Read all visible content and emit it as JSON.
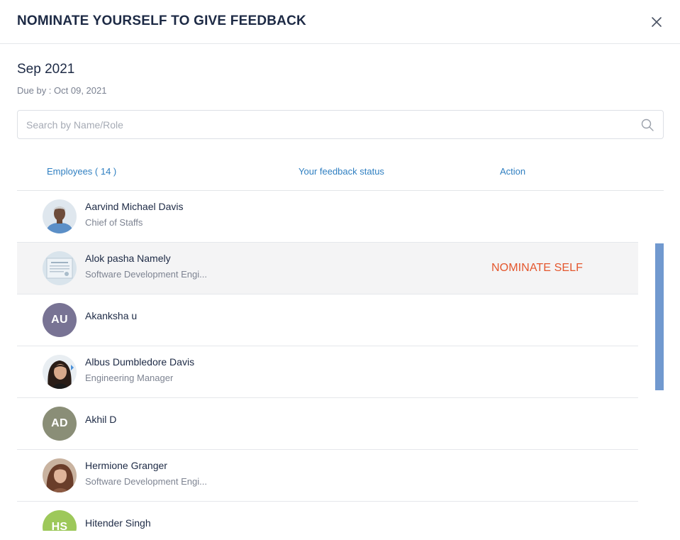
{
  "dialog": {
    "title": "NOMINATE YOURSELF TO GIVE FEEDBACK",
    "period": "Sep 2021",
    "due": "Due by : Oct 09, 2021",
    "search_placeholder": "Search by Name/Role",
    "search_value": ""
  },
  "columns": {
    "employees": "Employees ( 14 )",
    "status": "Your feedback status",
    "action": "Action"
  },
  "employees": [
    {
      "name": "Aarvind Michael Davis",
      "role": "Chief of Staffs",
      "avatar": "photo"
    },
    {
      "name": "Alok pasha Namely",
      "role": "Software Development Engi...",
      "avatar": "photo",
      "action": "NOMINATE SELF"
    },
    {
      "name": "Akanksha u",
      "initials": "AU",
      "avatar_color": "#787394"
    },
    {
      "name": "Albus Dumbledore Davis",
      "role": "Engineering Manager",
      "avatar": "photo"
    },
    {
      "name": "Akhil D",
      "initials": "AD",
      "avatar_color": "#8a8e77"
    },
    {
      "name": "Hermione Granger",
      "role": "Software Development Engi...",
      "avatar": "photo"
    },
    {
      "name": "Hitender Singh",
      "initials": "HS",
      "avatar_color": "#9dc85a"
    }
  ],
  "icons": {
    "close": "close-icon",
    "search": "search-icon"
  },
  "colors": {
    "accent": "#2f7fc1",
    "action": "#e4572e",
    "scrollbar": "#7199cf"
  }
}
